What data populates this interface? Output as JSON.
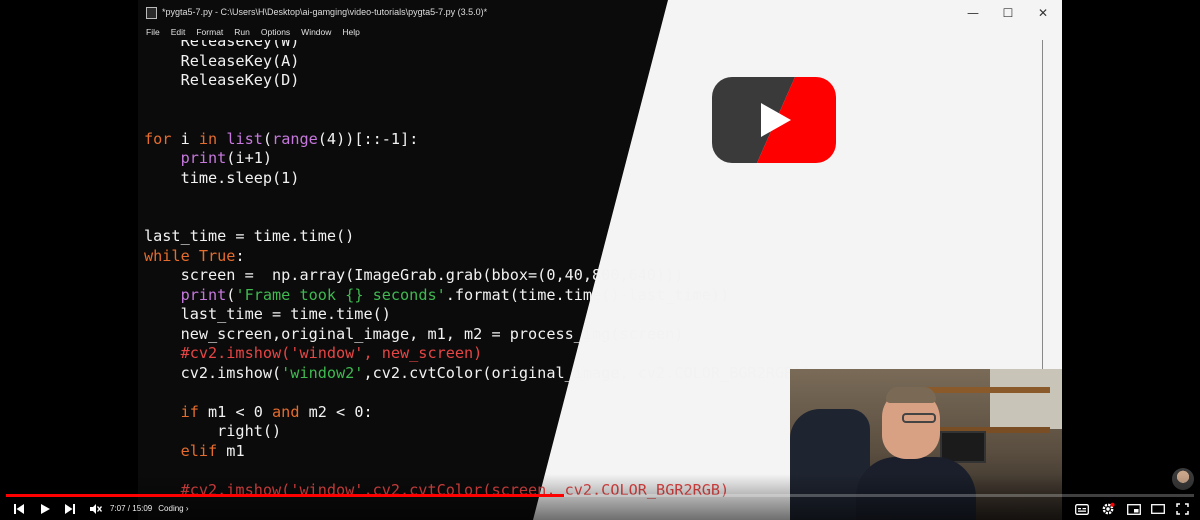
{
  "window": {
    "title": "*pygta5-7.py - C:\\Users\\H\\Desktop\\ai-gamging\\video-tutorials\\pygta5-7.py (3.5.0)*",
    "buttons": {
      "minimize": "—",
      "maximize": "☐",
      "close": "✕"
    }
  },
  "menu": [
    "File",
    "Edit",
    "Format",
    "Run",
    "Options",
    "Window",
    "Help"
  ],
  "code_lines": [
    [
      {
        "t": "    ReleaseKey(W)",
        "c": "plain"
      }
    ],
    [
      {
        "t": "    ReleaseKey(A)",
        "c": "plain"
      }
    ],
    [
      {
        "t": "    ReleaseKey(D)",
        "c": "plain"
      }
    ],
    [],
    [],
    [
      {
        "t": "for",
        "c": "kw"
      },
      {
        "t": " i ",
        "c": "plain"
      },
      {
        "t": "in",
        "c": "kw"
      },
      {
        "t": " ",
        "c": "plain"
      },
      {
        "t": "list",
        "c": "bi"
      },
      {
        "t": "(",
        "c": "plain"
      },
      {
        "t": "range",
        "c": "bi"
      },
      {
        "t": "(4))[::-1]:",
        "c": "plain"
      }
    ],
    [
      {
        "t": "    ",
        "c": "plain"
      },
      {
        "t": "print",
        "c": "bi"
      },
      {
        "t": "(i+1)",
        "c": "plain"
      }
    ],
    [
      {
        "t": "    time.sleep(1)",
        "c": "plain"
      }
    ],
    [],
    [],
    [
      {
        "t": "last_time = time.time()",
        "c": "plain"
      }
    ],
    [
      {
        "t": "while",
        "c": "kw"
      },
      {
        "t": " ",
        "c": "plain"
      },
      {
        "t": "True",
        "c": "kw"
      },
      {
        "t": ":",
        "c": "plain"
      }
    ],
    [
      {
        "t": "    screen =  np.array(ImageGrab.grab(bbox=(0,40,800,640)))",
        "c": "plain"
      }
    ],
    [
      {
        "t": "    ",
        "c": "plain"
      },
      {
        "t": "print",
        "c": "bi"
      },
      {
        "t": "(",
        "c": "plain"
      },
      {
        "t": "'Frame took {} seconds'",
        "c": "str"
      },
      {
        "t": ".format(time.time()-last_time))",
        "c": "plain"
      }
    ],
    [
      {
        "t": "    last_time = time.time()",
        "c": "plain"
      }
    ],
    [
      {
        "t": "    new_screen,original_image, m1, m2 = process_img(screen)",
        "c": "plain"
      }
    ],
    [
      {
        "t": "    #cv2.imshow('window', new_screen)",
        "c": "cmt"
      }
    ],
    [
      {
        "t": "    cv2.imshow(",
        "c": "plain"
      },
      {
        "t": "'window2'",
        "c": "str"
      },
      {
        "t": ",cv2.cvtColor(original_image, cv2.COLOR_BGR2RGB))",
        "c": "plain"
      }
    ],
    [],
    [
      {
        "t": "    ",
        "c": "plain"
      },
      {
        "t": "if",
        "c": "kw"
      },
      {
        "t": " m1 < 0 ",
        "c": "plain"
      },
      {
        "t": "and",
        "c": "kw"
      },
      {
        "t": " m2 < 0:",
        "c": "plain"
      }
    ],
    [
      {
        "t": "        right()",
        "c": "plain"
      }
    ],
    [
      {
        "t": "    ",
        "c": "plain"
      },
      {
        "t": "elif",
        "c": "kw"
      },
      {
        "t": " m1",
        "c": "plain"
      }
    ],
    [],
    [
      {
        "t": "    #cv2.imshow('window',cv2.cvtColor(screen, cv2.COLOR_BGR2RGB)",
        "c": "cmt"
      }
    ]
  ],
  "player": {
    "current_time": "7:07",
    "duration": "15:09",
    "time_display": "7:07 / 15:09",
    "chapter": "Coding",
    "chapter_chevron": "›",
    "progress_fraction": 0.47,
    "colors": {
      "progress": "#ff0000",
      "yt_red": "#ff0000"
    },
    "icons": [
      "previous-icon",
      "play-icon",
      "next-icon",
      "mute-icon",
      "subtitles-icon",
      "settings-icon",
      "miniplayer-icon",
      "theater-icon",
      "fullscreen-icon"
    ]
  }
}
